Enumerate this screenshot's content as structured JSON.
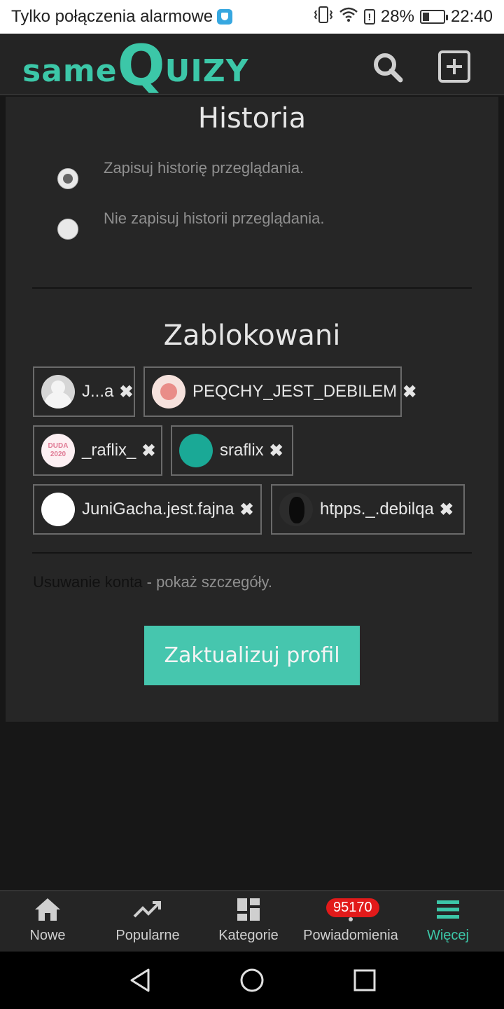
{
  "status_bar": {
    "carrier": "Tylko połączenia alarmowe",
    "battery_percent": "28%",
    "time": "22:40"
  },
  "header": {
    "logo_same": "same",
    "logo_q": "Q",
    "logo_uizy": "UIZY",
    "search_icon": "search-icon",
    "add_icon": "plus-square-icon"
  },
  "history": {
    "title": "Historia",
    "options": [
      {
        "label": "Zapisuj historię przeglądania.",
        "checked": true
      },
      {
        "label": "Nie zapisuj historii przeglądania.",
        "checked": false
      }
    ]
  },
  "blocked": {
    "title": "Zablokowani",
    "users": [
      {
        "name": "J...a"
      },
      {
        "name": "PEQCHY_JEST_DEBILEM"
      },
      {
        "name": "_raflix_",
        "avatar_text": "DUDA 2020"
      },
      {
        "name": "sraflix"
      },
      {
        "name": "JuniGacha.jest.fajna"
      },
      {
        "name": "htpps._.debilqa"
      }
    ]
  },
  "account": {
    "delete_link": "Usuwanie konta",
    "delete_rest": " - pokaż szczegóły."
  },
  "update_button": "Zaktualizuj profil",
  "bottom_nav": {
    "items": [
      {
        "label": "Nowe",
        "icon": "home-icon"
      },
      {
        "label": "Popularne",
        "icon": "trending-icon"
      },
      {
        "label": "Kategorie",
        "icon": "dashboard-icon"
      },
      {
        "label": "Powiadomienia",
        "icon": "bell-icon",
        "badge": "95170"
      },
      {
        "label": "Więcej",
        "icon": "menu-icon",
        "active": true
      }
    ]
  },
  "colors": {
    "accent": "#3cc7a8",
    "button": "#46c6ae",
    "badge": "#e21a1a"
  }
}
